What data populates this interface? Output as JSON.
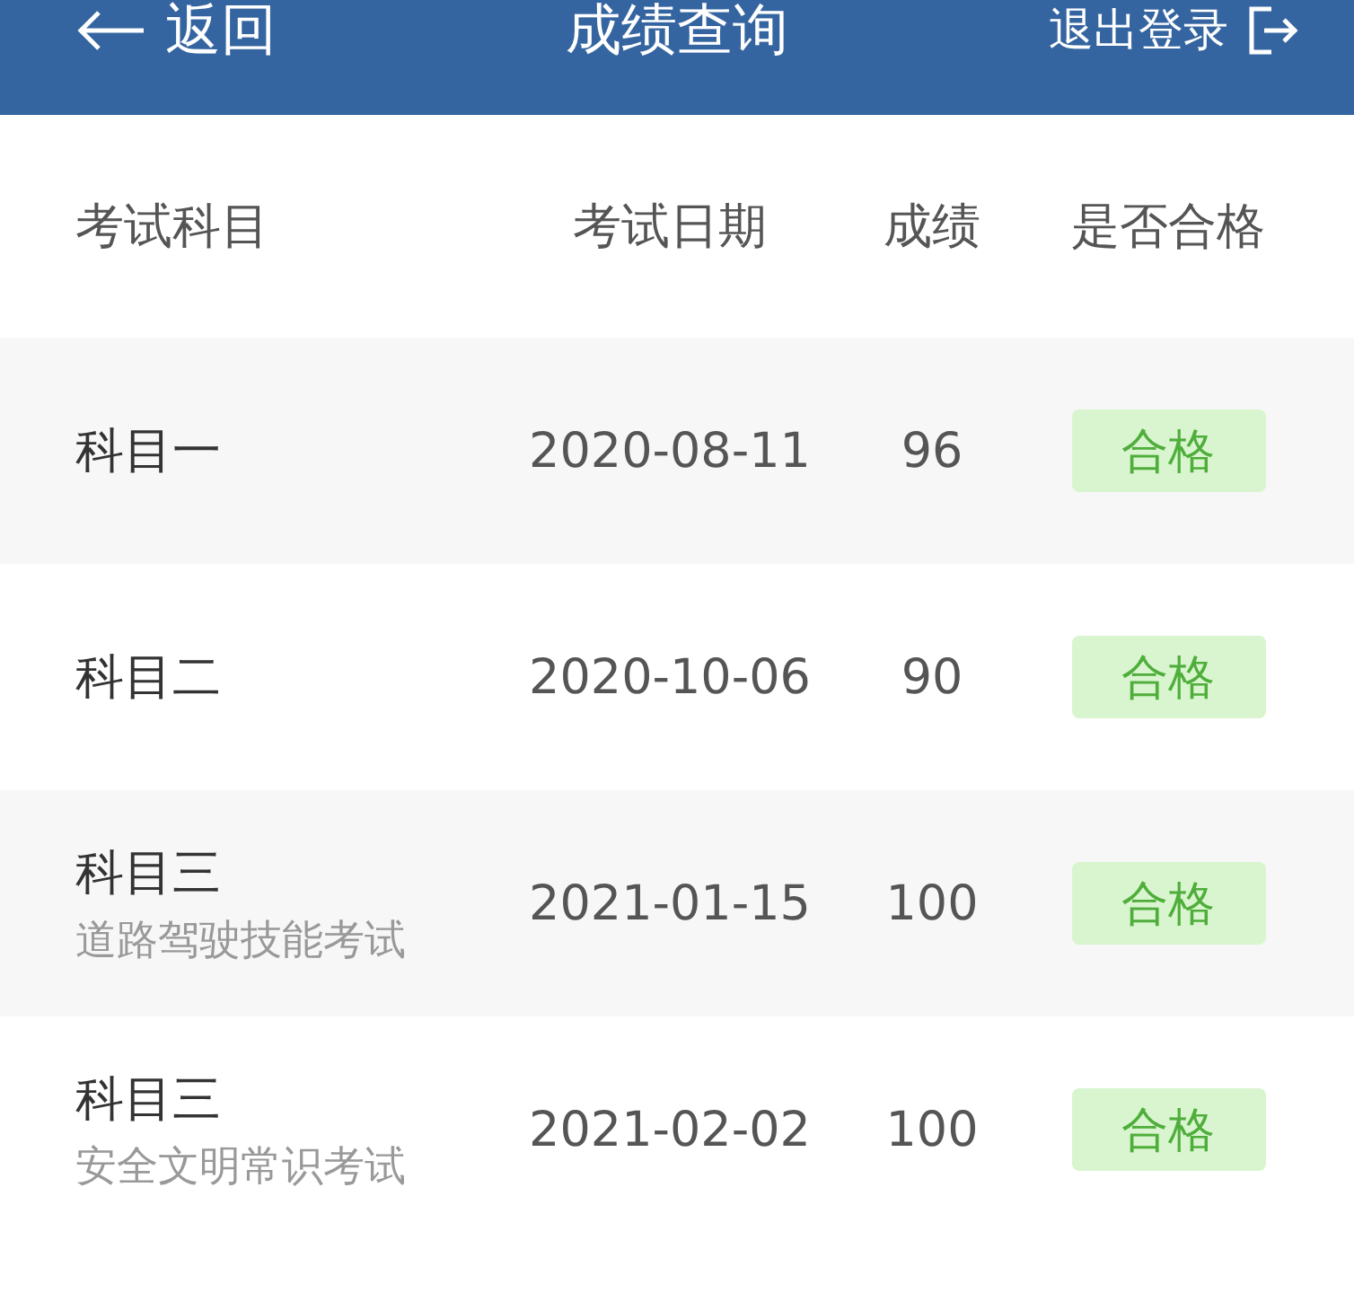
{
  "header": {
    "back": "返回",
    "title": "成绩查询",
    "logout": "退出登录"
  },
  "columns": [
    "考试科目",
    "考试日期",
    "成绩",
    "是否合格"
  ],
  "rows": [
    {
      "subject": "科目一",
      "date": "2020-08-11",
      "score": "96",
      "result": "合格",
      "passed": true
    },
    {
      "subject": "科目二",
      "date": "2020-10-06",
      "score": "90",
      "result": "合格",
      "passed": true
    },
    {
      "subject": "科目三",
      "note": "道路驾驶技能考试",
      "date": "2021-01-15",
      "score": "100",
      "result": "合格",
      "passed": true
    },
    {
      "subject": "科目三",
      "note": "安全文明常识考试",
      "date": "2021-02-02",
      "score": "100",
      "result": "合格",
      "passed": true
    }
  ]
}
